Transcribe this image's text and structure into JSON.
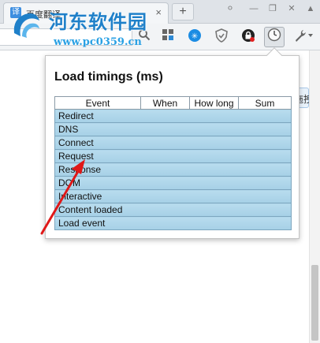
{
  "browser": {
    "tab_title": "百度翻译",
    "tab_close": "×",
    "new_tab": "+",
    "tab_favicon": "译"
  },
  "toolbar": {
    "icons": [
      "search-icon",
      "apps-grid-icon",
      "extension-icon",
      "shield-icon",
      "lock-icon",
      "page-timer-icon",
      "wrench-icon"
    ]
  },
  "watermark": {
    "title": "河东软件园",
    "url": "www.pc0359.cn"
  },
  "side_tab": {
    "label": "拖拽"
  },
  "popup": {
    "title": "Load timings (ms)",
    "columns": [
      "Event",
      "When",
      "How long",
      "Sum"
    ],
    "rows": [
      {
        "event": "Redirect",
        "when": "",
        "how_long": "",
        "sum": ""
      },
      {
        "event": "DNS",
        "when": "",
        "how_long": "",
        "sum": ""
      },
      {
        "event": "Connect",
        "when": "",
        "how_long": "",
        "sum": ""
      },
      {
        "event": "Request",
        "when": "",
        "how_long": "",
        "sum": ""
      },
      {
        "event": "Response",
        "when": "",
        "how_long": "",
        "sum": ""
      },
      {
        "event": "DOM",
        "when": "",
        "how_long": "",
        "sum": ""
      },
      {
        "event": "Interactive",
        "when": "",
        "how_long": "",
        "sum": ""
      },
      {
        "event": "Content loaded",
        "when": "",
        "how_long": "",
        "sum": ""
      },
      {
        "event": "Load event",
        "when": "",
        "how_long": "",
        "sum": ""
      }
    ]
  },
  "colors": {
    "row_fill": "#acd4e8",
    "annotation_arrow": "#e01818",
    "watermark_blue": "#1f80c9"
  }
}
